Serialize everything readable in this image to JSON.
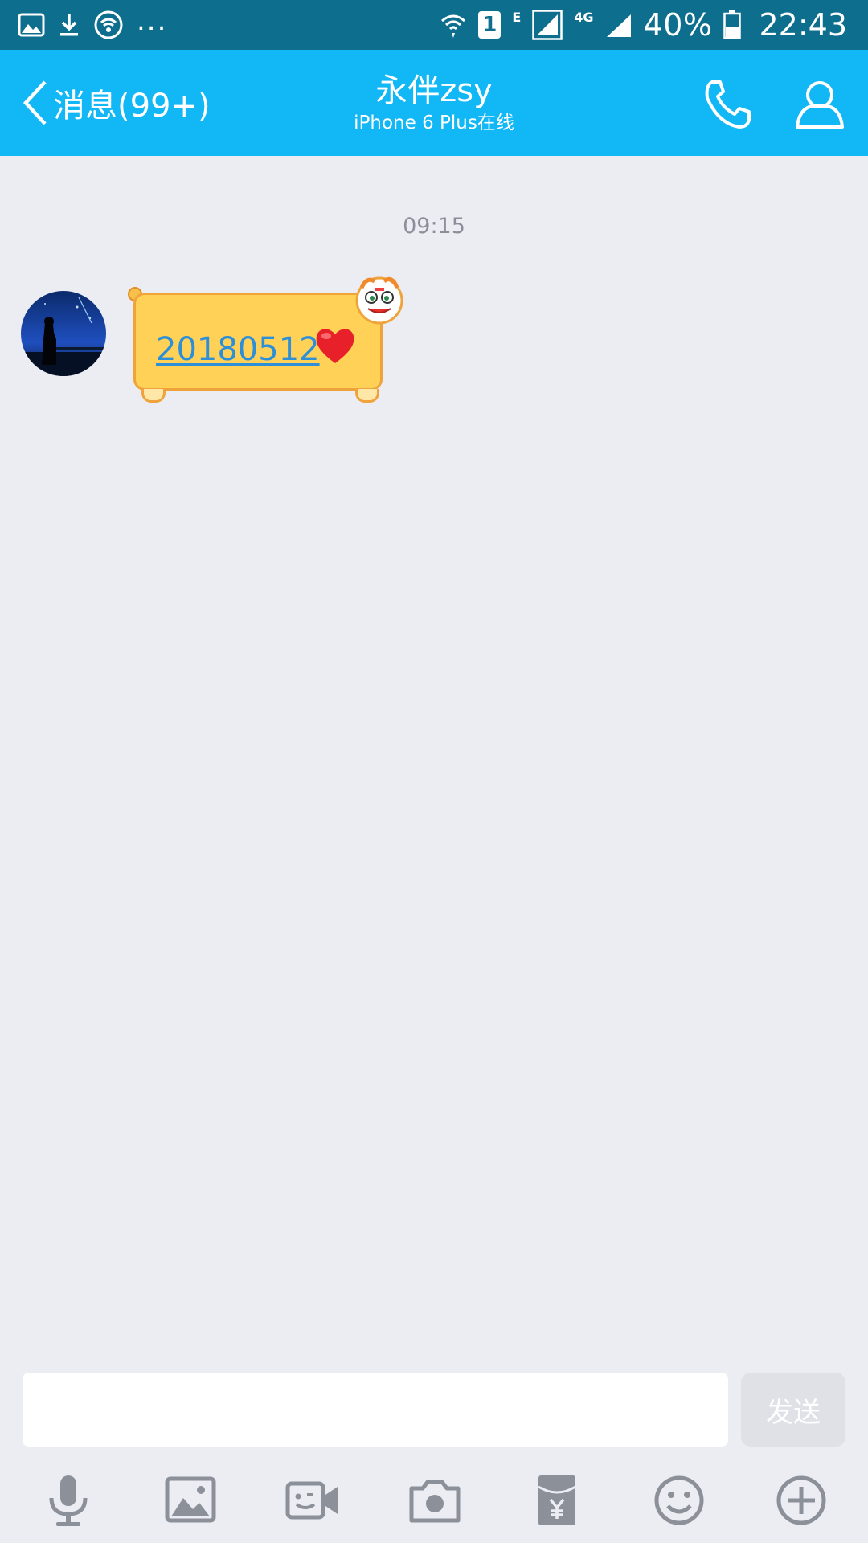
{
  "status_bar": {
    "more": "...",
    "sim_slot": "1",
    "network_e": "E",
    "network_4g": "4G",
    "battery_percent": "40%",
    "time": "22:43"
  },
  "header": {
    "back_label": "消息(99+)",
    "contact_name": "永伴zsy",
    "contact_status": "iPhone 6 Plus在线"
  },
  "conversation": {
    "timestamp": "09:15",
    "messages": [
      {
        "sender": "contact",
        "text": "20180512",
        "emoji": "heart"
      }
    ]
  },
  "composer": {
    "input_value": "",
    "send_label": "发送"
  },
  "toolbar": {
    "icons": [
      "microphone-icon",
      "image-icon",
      "video-call-icon",
      "camera-icon",
      "red-packet-icon",
      "emoji-icon",
      "plus-icon"
    ]
  },
  "colors": {
    "status_bar": "#0e6e8e",
    "title_bar": "#12b7f5",
    "background": "#ebedf3",
    "bubble": "#ffd257",
    "link": "#2d8fd8"
  }
}
